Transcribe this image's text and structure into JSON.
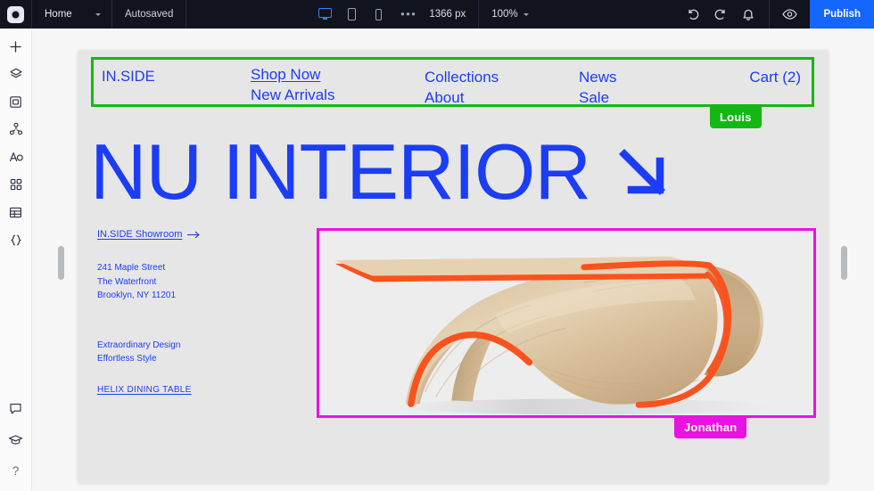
{
  "topbar": {
    "logo_icon": "app-logo-ring-icon",
    "page_name": "Home",
    "page_caret_icon": "chevron-down-icon",
    "autosave_status": "Autosaved",
    "devices": [
      {
        "name": "desktop",
        "icon": "monitor-icon",
        "active": true
      },
      {
        "name": "tablet",
        "icon": "tablet-icon",
        "active": false
      },
      {
        "name": "mobile",
        "icon": "phone-icon",
        "active": false
      }
    ],
    "more_icon": "ellipsis-icon",
    "breakpoint_width": "1366 px",
    "zoom_level": "100%",
    "zoom_caret_icon": "chevron-down-icon",
    "undo_icon": "undo-arrow-icon",
    "redo_icon": "redo-arrow-icon",
    "notifications_icon": "bell-icon",
    "preview_icon": "eye-icon",
    "publish_label": "Publish",
    "accent_color": "#1565ff",
    "bar_color": "#11131f"
  },
  "rail": {
    "top_items": [
      {
        "name": "add",
        "icon": "plus-icon"
      },
      {
        "name": "layers",
        "icon": "layers-icon"
      },
      {
        "name": "pages",
        "icon": "page-panel-icon"
      },
      {
        "name": "components",
        "icon": "node-tree-icon"
      },
      {
        "name": "typography",
        "icon": "text-style-icon"
      },
      {
        "name": "apps",
        "icon": "grid-apps-icon"
      },
      {
        "name": "cms",
        "icon": "table-icon"
      },
      {
        "name": "code",
        "icon": "curly-braces-icon"
      }
    ],
    "bottom_items": [
      {
        "name": "comments",
        "icon": "comment-bubble-icon"
      },
      {
        "name": "learn",
        "icon": "graduation-cap-icon"
      },
      {
        "name": "help",
        "icon": "question-mark-icon",
        "glyph": "?"
      }
    ]
  },
  "canvas": {
    "left_handle": "canvas-resize-handle-left",
    "right_handle": "canvas-resize-handle-right",
    "page_background": "#e7e6e6"
  },
  "selections": [
    {
      "name": "nav-selection",
      "color": "#14b814",
      "label": "Louis"
    },
    {
      "name": "image-selection",
      "color": "#ea12e0",
      "label": "Jonathan"
    }
  ],
  "site": {
    "brand": "IN.SIDE",
    "nav": {
      "col1": [
        "Shop Now",
        "New Arrivals"
      ],
      "col2": [
        "Collections",
        "About"
      ],
      "col3": [
        "News",
        "Sale"
      ],
      "cart": "Cart (2)"
    },
    "hero_title": "NU INTERIOR",
    "hero_arrow_icon": "arrow-down-right-icon",
    "showroom_link": "IN.SIDE Showroom",
    "showroom_arrow_icon": "arrow-right-icon",
    "address": [
      "241 Maple Street",
      "The Waterfront",
      "Brooklyn, NY 11201"
    ],
    "tagline": [
      "Extraordinary Design",
      "Effortless Style"
    ],
    "product_link": "HELIX DINING TABLE",
    "hero_image": {
      "name": "bentwood-curved-table-photo",
      "alt": "Curved bent-plywood table with orange edge trim"
    },
    "text_color": "#1b3df5"
  }
}
